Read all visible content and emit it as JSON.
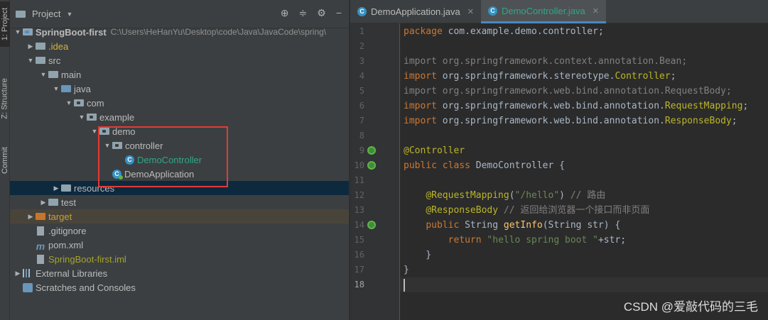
{
  "left_strip": [
    "1: Project",
    "Z: Structure",
    "Commit"
  ],
  "project_panel": {
    "title": "Project",
    "tree": [
      {
        "label": "SpringBoot-first",
        "path": "C:\\Users\\HeHanYu\\Desktop\\code\\Java\\JavaCode\\spring\\",
        "depth": 0,
        "arrow": "down",
        "icon": "module-folder",
        "color": "normal",
        "bold": true
      },
      {
        "label": ".idea",
        "depth": 1,
        "arrow": "right",
        "icon": "folder",
        "color": "idea"
      },
      {
        "label": "src",
        "depth": 1,
        "arrow": "down",
        "icon": "folder",
        "color": "normal"
      },
      {
        "label": "main",
        "depth": 2,
        "arrow": "down",
        "icon": "folder",
        "color": "normal"
      },
      {
        "label": "java",
        "depth": 3,
        "arrow": "down",
        "icon": "source-folder",
        "color": "normal"
      },
      {
        "label": "com",
        "depth": 4,
        "arrow": "down",
        "icon": "package",
        "color": "normal"
      },
      {
        "label": "example",
        "depth": 5,
        "arrow": "down",
        "icon": "package",
        "color": "normal"
      },
      {
        "label": "demo",
        "depth": 6,
        "arrow": "down",
        "icon": "package",
        "color": "normal"
      },
      {
        "label": "controller",
        "depth": 7,
        "arrow": "down",
        "icon": "package",
        "color": "normal"
      },
      {
        "label": "DemoController",
        "depth": 8,
        "arrow": "none",
        "icon": "class",
        "color": "green2"
      },
      {
        "label": "DemoApplication",
        "depth": 7,
        "arrow": "none",
        "icon": "app-class",
        "color": "normal"
      },
      {
        "label": "resources",
        "depth": 3,
        "arrow": "right",
        "icon": "resource-folder",
        "color": "normal",
        "selected": true
      },
      {
        "label": "test",
        "depth": 2,
        "arrow": "right",
        "icon": "folder",
        "color": "normal"
      },
      {
        "label": "target",
        "depth": 1,
        "arrow": "right",
        "icon": "excluded-folder",
        "color": "orange",
        "excluded": true
      },
      {
        "label": ".gitignore",
        "depth": 1,
        "arrow": "none",
        "icon": "file",
        "color": "normal"
      },
      {
        "label": "pom.xml",
        "depth": 1,
        "arrow": "none",
        "icon": "maven",
        "color": "normal"
      },
      {
        "label": "SpringBoot-first.iml",
        "depth": 1,
        "arrow": "none",
        "icon": "file",
        "color": "yellow"
      },
      {
        "label": "External Libraries",
        "depth": 0,
        "arrow": "right",
        "icon": "library",
        "color": "normal"
      },
      {
        "label": "Scratches and Consoles",
        "depth": 0,
        "arrow": "none",
        "icon": "scratch",
        "color": "normal"
      }
    ]
  },
  "editor_tabs": [
    {
      "label": "DemoApplication.java",
      "active": false
    },
    {
      "label": "DemoController.java",
      "active": true
    }
  ],
  "code_lines": [
    [
      [
        "kw",
        "package "
      ],
      [
        "plain",
        "com.example.demo.controller;"
      ]
    ],
    [],
    [
      [
        "gray",
        "import org.springframework.context.annotation.Bean;"
      ]
    ],
    [
      [
        "kw",
        "import "
      ],
      [
        "plain",
        "org.springframework.stereotype."
      ],
      [
        "ann",
        "Controller"
      ],
      [
        "plain",
        ";"
      ]
    ],
    [
      [
        "gray",
        "import org.springframework.web.bind.annotation.RequestBody;"
      ]
    ],
    [
      [
        "kw",
        "import "
      ],
      [
        "plain",
        "org.springframework.web.bind.annotation."
      ],
      [
        "ann",
        "RequestMapping"
      ],
      [
        "plain",
        ";"
      ]
    ],
    [
      [
        "kw",
        "import "
      ],
      [
        "plain",
        "org.springframework.web.bind.annotation."
      ],
      [
        "ann",
        "ResponseBody"
      ],
      [
        "plain",
        ";"
      ]
    ],
    [],
    [
      [
        "ann",
        "@Controller"
      ]
    ],
    [
      [
        "kw",
        "public class "
      ],
      [
        "plain",
        "DemoController {"
      ]
    ],
    [],
    [
      [
        "plain",
        "    "
      ],
      [
        "ann",
        "@RequestMapping"
      ],
      [
        "plain",
        "("
      ],
      [
        "str",
        "\"/hello\""
      ],
      [
        "plain",
        ") "
      ],
      [
        "cm",
        "// 路由"
      ]
    ],
    [
      [
        "plain",
        "    "
      ],
      [
        "ann",
        "@ResponseBody"
      ],
      [
        "plain",
        " "
      ],
      [
        "cm",
        "// 返回给浏览器一个接口而非页面"
      ]
    ],
    [
      [
        "plain",
        "    "
      ],
      [
        "kw",
        "public "
      ],
      [
        "plain",
        "String "
      ],
      [
        "fn",
        "getInfo"
      ],
      [
        "plain",
        "(String str) {"
      ]
    ],
    [
      [
        "plain",
        "        "
      ],
      [
        "kw",
        "return "
      ],
      [
        "str",
        "\"hello spring boot \""
      ],
      [
        "plain",
        "+str;"
      ]
    ],
    [
      [
        "plain",
        "    }"
      ]
    ],
    [
      [
        "plain",
        "}"
      ]
    ],
    []
  ],
  "gutter_markers": [
    9,
    10,
    14
  ],
  "current_line": 18,
  "watermark": "CSDN @爱敲代码的三毛"
}
